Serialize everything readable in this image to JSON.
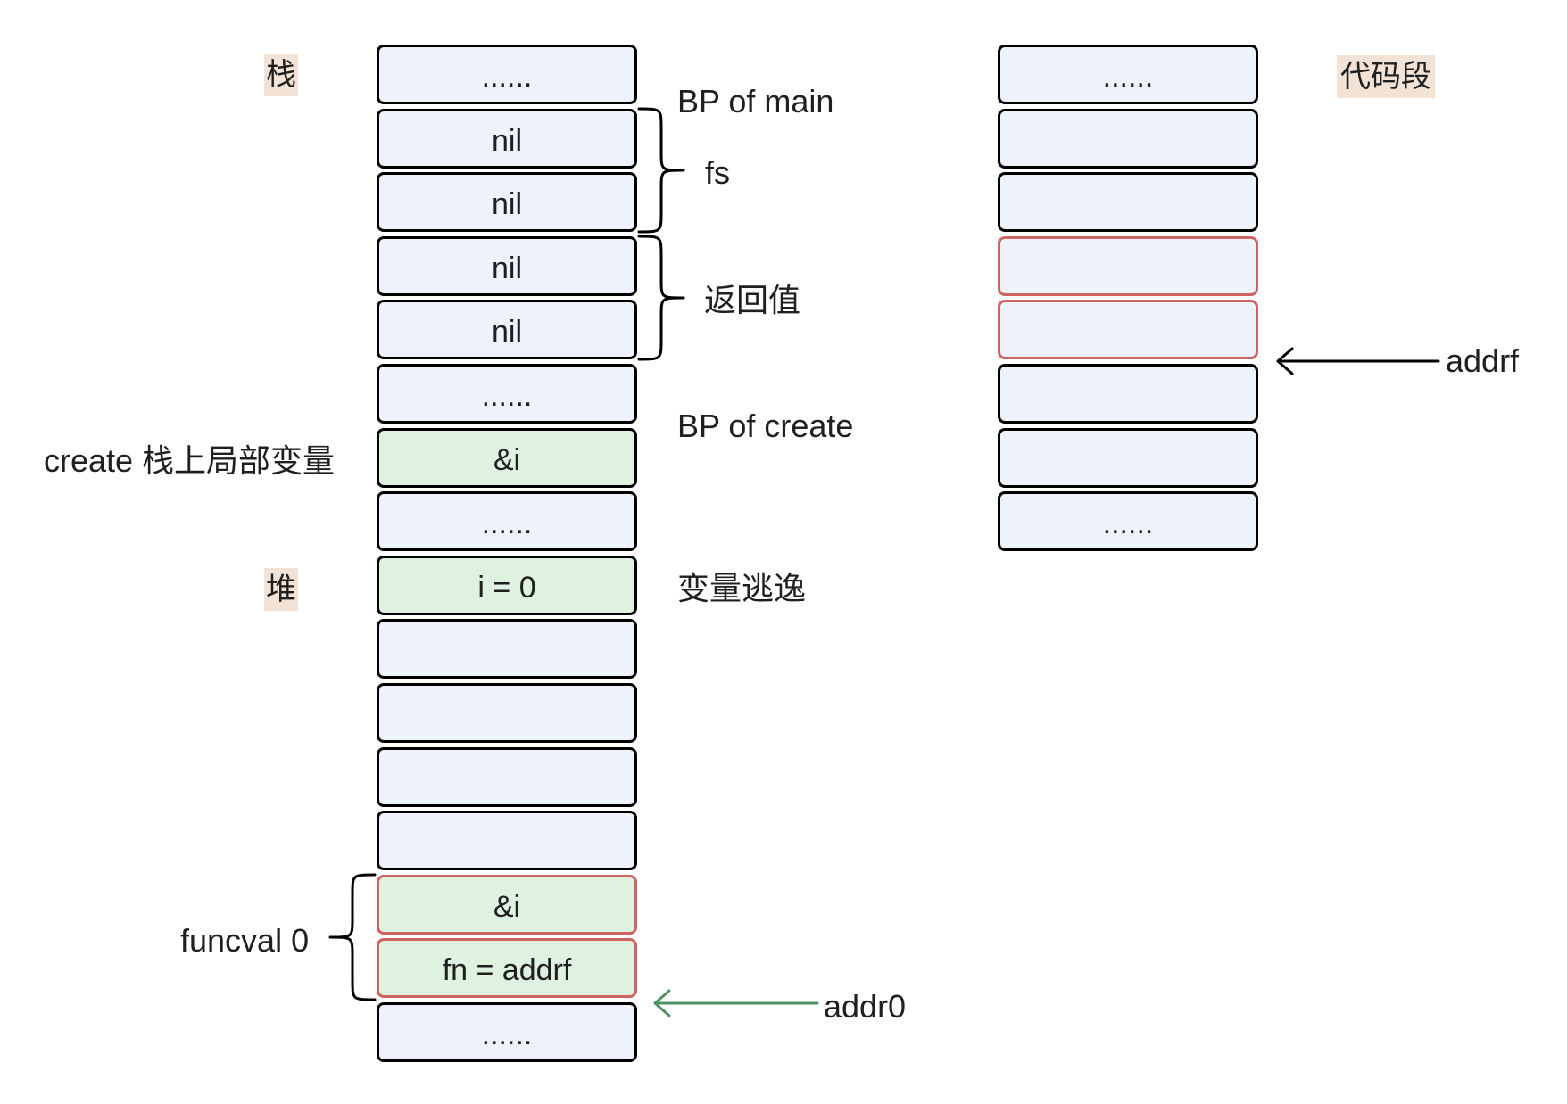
{
  "colors": {
    "cell_fill": "#eef2fb",
    "cell_border": "#000000",
    "highlight_fill": "#dff2e1",
    "escape_border": "#cd6461",
    "tag_background": "#f2e3d6",
    "addr0_arrow": "#4f9060",
    "addrf_arrow": "#000000",
    "text": "#1f1f1f"
  },
  "stack": {
    "label": "栈",
    "cells": [
      "......",
      "nil",
      "nil",
      "nil",
      "nil",
      "......",
      "&i",
      "......",
      "i = 0",
      "",
      "",
      "",
      "",
      "&i",
      "fn = addrf",
      "......"
    ]
  },
  "heap": {
    "label": "堆"
  },
  "code_segment": {
    "label": "代码段",
    "cells": [
      "......",
      "",
      "",
      "",
      "",
      "",
      "",
      "......"
    ]
  },
  "annotations": {
    "bp_of_main": "BP of main",
    "fs": "fs",
    "return_values": "返回值",
    "bp_of_create": "BP of create",
    "create_locals": "create 栈上局部变量",
    "escape": "变量逃逸",
    "funcval": "funcval 0",
    "addr0": "addr0",
    "addrf": "addrf"
  }
}
